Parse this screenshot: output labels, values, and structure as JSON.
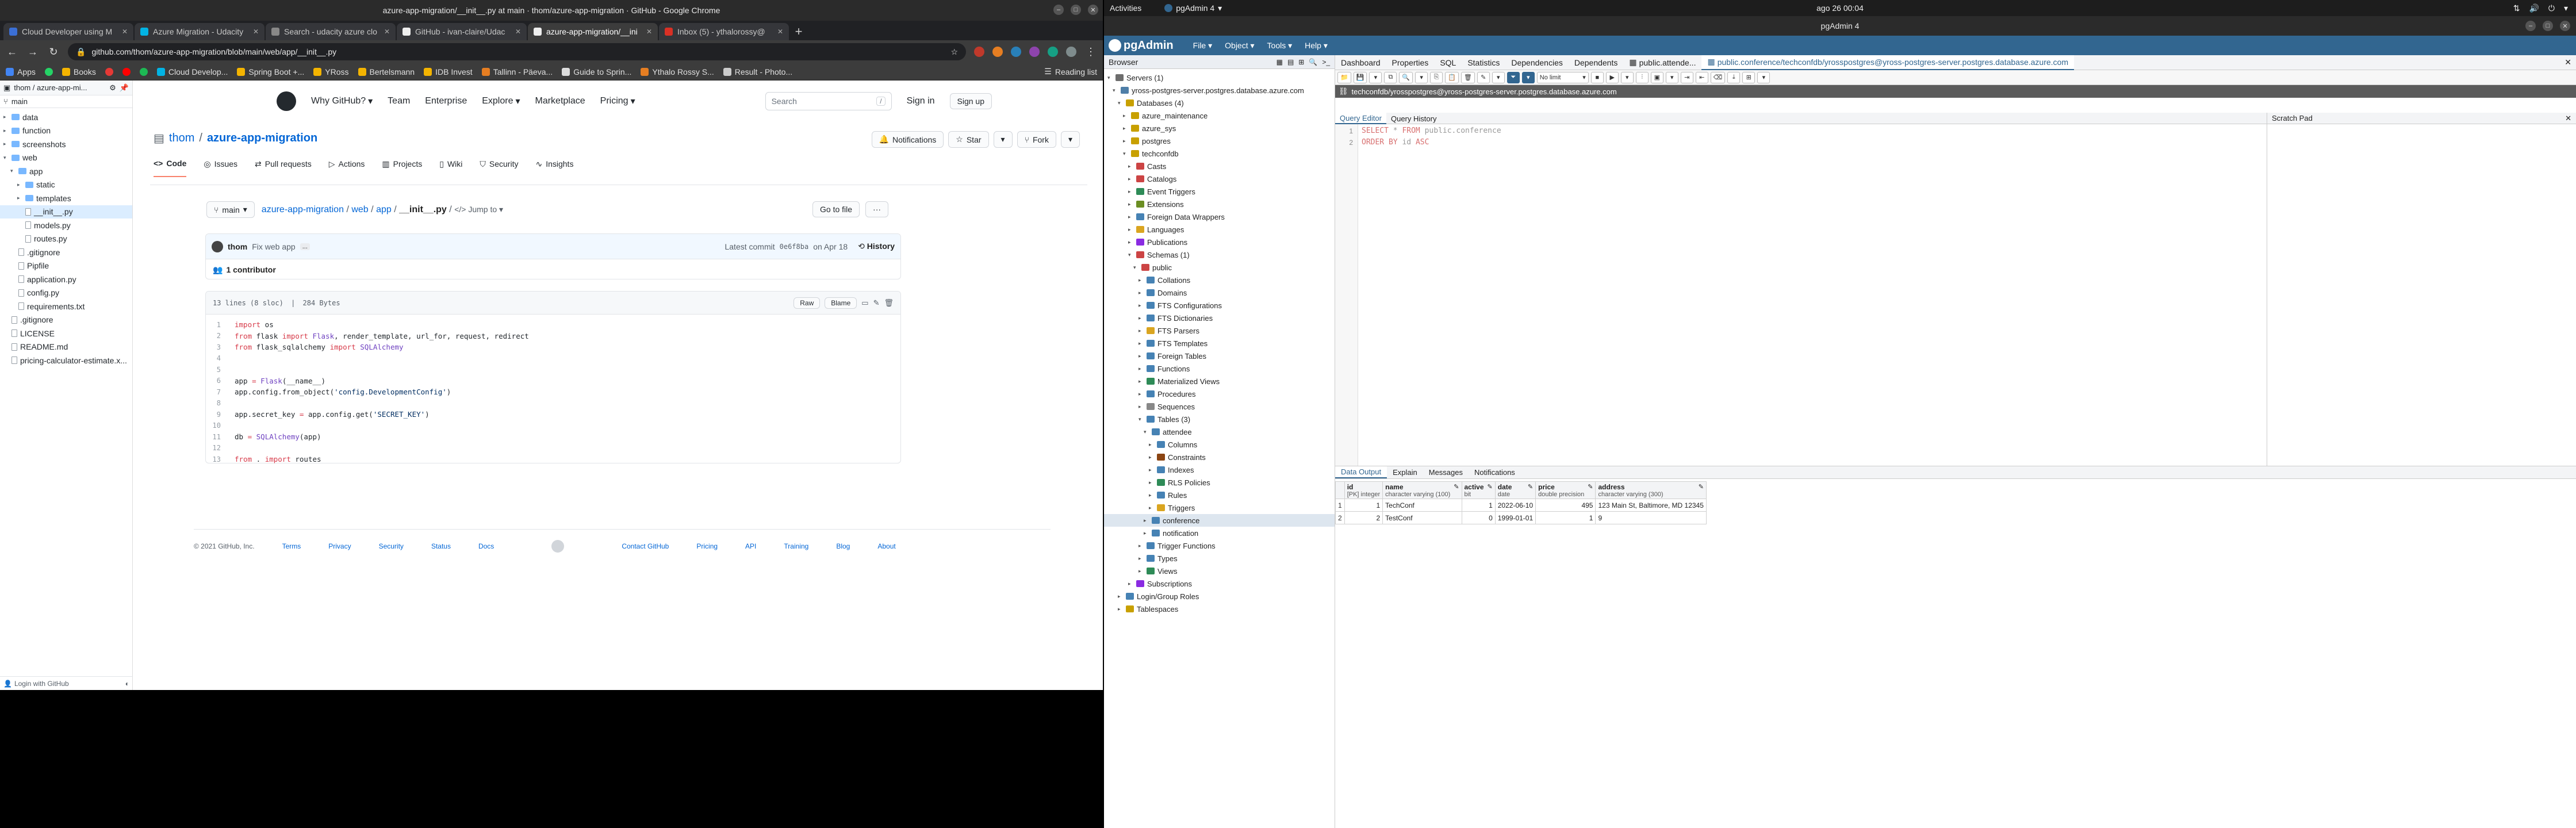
{
  "chrome": {
    "window_title": "azure-app-migration/__init__.py at main · thom/azure-app-migration · GitHub - Google Chrome",
    "tabs": [
      {
        "label": "Cloud Developer using M",
        "active": false
      },
      {
        "label": "Azure Migration - Udacity",
        "active": false
      },
      {
        "label": "Search - udacity azure clo",
        "active": false
      },
      {
        "label": "GitHub - ivan-claire/Udac",
        "active": false
      },
      {
        "label": "azure-app-migration/__ini",
        "active": true
      },
      {
        "label": "Inbox (5) - ythalorossy@",
        "active": false
      }
    ],
    "url": "github.com/thom/azure-app-migration/blob/main/web/app/__init__.py",
    "bookmarks": [
      "Apps",
      "Books",
      "Cloud Develop...",
      "Spring Boot +...",
      "YRoss",
      "Bertelsmann",
      "IDB Invest",
      "Tallinn - Päeva...",
      "Guide to Sprin...",
      "Ythalo Rossy S...",
      "Result - Photo..."
    ],
    "reading_list": "Reading list"
  },
  "octotree": {
    "repo": "thom / azure-app-mi...",
    "branch": "main",
    "items": [
      {
        "label": "data",
        "type": "folder",
        "depth": 0,
        "open": false
      },
      {
        "label": "function",
        "type": "folder",
        "depth": 0,
        "open": false
      },
      {
        "label": "screenshots",
        "type": "folder",
        "depth": 0,
        "open": false
      },
      {
        "label": "web",
        "type": "folder",
        "depth": 0,
        "open": true
      },
      {
        "label": "app",
        "type": "folder",
        "depth": 1,
        "open": true
      },
      {
        "label": "static",
        "type": "folder",
        "depth": 2,
        "open": false
      },
      {
        "label": "templates",
        "type": "folder",
        "depth": 2,
        "open": false
      },
      {
        "label": "__init__.py",
        "type": "file",
        "depth": 2,
        "selected": true
      },
      {
        "label": "models.py",
        "type": "file",
        "depth": 2
      },
      {
        "label": "routes.py",
        "type": "file",
        "depth": 2
      },
      {
        "label": ".gitignore",
        "type": "file",
        "depth": 1
      },
      {
        "label": "Pipfile",
        "type": "file",
        "depth": 1
      },
      {
        "label": "application.py",
        "type": "file",
        "depth": 1
      },
      {
        "label": "config.py",
        "type": "file",
        "depth": 1
      },
      {
        "label": "requirements.txt",
        "type": "file",
        "depth": 1
      },
      {
        "label": ".gitignore",
        "type": "file",
        "depth": 0
      },
      {
        "label": "LICENSE",
        "type": "file",
        "depth": 0
      },
      {
        "label": "README.md",
        "type": "file",
        "depth": 0
      },
      {
        "label": "pricing-calculator-estimate.x...",
        "type": "file",
        "depth": 0
      }
    ],
    "footer": "Login with GitHub"
  },
  "github": {
    "nav": [
      "Why GitHub?",
      "Team",
      "Enterprise",
      "Explore",
      "Marketplace",
      "Pricing"
    ],
    "search_placeholder": "Search",
    "search_key": "/",
    "sign_in": "Sign in",
    "sign_up": "Sign up",
    "owner": "thom",
    "repo": "azure-app-migration",
    "notifications": "Notifications",
    "star": "Star",
    "fork": "Fork",
    "repo_tabs": [
      "Code",
      "Issues",
      "Pull requests",
      "Actions",
      "Projects",
      "Wiki",
      "Security",
      "Insights"
    ],
    "branch": "main",
    "breadcrumb": {
      "repo": "azure-app-migration",
      "web": "web",
      "app": "app",
      "file": "__init__.py",
      "jump": "Jump to"
    },
    "go_to_file": "Go to file",
    "more": "···",
    "commit": {
      "author": "thom",
      "message": "Fix web app",
      "more": "...",
      "latest": "Latest commit",
      "sha": "0e6f8ba",
      "date": "on Apr 18",
      "history": "History"
    },
    "contributors": "1 contributor",
    "file_info": {
      "lines": "13 lines (8 sloc)",
      "size": "284 Bytes"
    },
    "file_buttons": {
      "raw": "Raw",
      "blame": "Blame"
    },
    "code_lines": [
      "import os",
      "from flask import Flask, render_template, url_for, request, redirect",
      "from flask_sqlalchemy import SQLAlchemy",
      "",
      "",
      "app = Flask(__name__)",
      "app.config.from_object('config.DevelopmentConfig')",
      "",
      "app.secret_key = app.config.get('SECRET_KEY')",
      "",
      "db = SQLAlchemy(app)",
      "",
      "from . import routes"
    ],
    "footer": {
      "copyright": "© 2021 GitHub, Inc.",
      "links_left": [
        "Terms",
        "Privacy",
        "Security",
        "Status",
        "Docs"
      ],
      "links_right": [
        "Contact GitHub",
        "Pricing",
        "API",
        "Training",
        "Blog",
        "About"
      ]
    }
  },
  "gnome": {
    "activities": "Activities",
    "app": "pgAdmin 4",
    "clock": "ago 26 00:04"
  },
  "pgadmin": {
    "window_title": "pgAdmin 4",
    "logo": "pgAdmin",
    "menus": [
      "File",
      "Object",
      "Tools",
      "Help"
    ],
    "browser_title": "Browser",
    "tree": [
      {
        "label": "Servers (1)",
        "depth": 0,
        "color": "#6d6d6d"
      },
      {
        "label": "yross-postgres-server.postgres.database.azure.com",
        "depth": 1,
        "color": "#4f7fa8"
      },
      {
        "label": "Databases (4)",
        "depth": 2,
        "color": "#c8a000"
      },
      {
        "label": "azure_maintenance",
        "depth": 3,
        "color": "#c8a000"
      },
      {
        "label": "azure_sys",
        "depth": 3,
        "color": "#c8a000"
      },
      {
        "label": "postgres",
        "depth": 3,
        "color": "#c8a000"
      },
      {
        "label": "techconfdb",
        "depth": 3,
        "color": "#c8a000"
      },
      {
        "label": "Casts",
        "depth": 4,
        "color": "#cc4444"
      },
      {
        "label": "Catalogs",
        "depth": 4,
        "color": "#cc4444"
      },
      {
        "label": "Event Triggers",
        "depth": 4,
        "color": "#2e8b57"
      },
      {
        "label": "Extensions",
        "depth": 4,
        "color": "#6b8e23"
      },
      {
        "label": "Foreign Data Wrappers",
        "depth": 4,
        "color": "#4682b4"
      },
      {
        "label": "Languages",
        "depth": 4,
        "color": "#daa520"
      },
      {
        "label": "Publications",
        "depth": 4,
        "color": "#8a2be2"
      },
      {
        "label": "Schemas (1)",
        "depth": 4,
        "color": "#cc4444"
      },
      {
        "label": "public",
        "depth": 5,
        "color": "#cc4444"
      },
      {
        "label": "Collations",
        "depth": 6,
        "color": "#4682b4"
      },
      {
        "label": "Domains",
        "depth": 6,
        "color": "#4682b4"
      },
      {
        "label": "FTS Configurations",
        "depth": 6,
        "color": "#4682b4"
      },
      {
        "label": "FTS Dictionaries",
        "depth": 6,
        "color": "#4682b4"
      },
      {
        "label": "FTS Parsers",
        "depth": 6,
        "color": "#daa520"
      },
      {
        "label": "FTS Templates",
        "depth": 6,
        "color": "#4682b4"
      },
      {
        "label": "Foreign Tables",
        "depth": 6,
        "color": "#4682b4"
      },
      {
        "label": "Functions",
        "depth": 6,
        "color": "#4682b4"
      },
      {
        "label": "Materialized Views",
        "depth": 6,
        "color": "#2e8b57"
      },
      {
        "label": "Procedures",
        "depth": 6,
        "color": "#4682b4"
      },
      {
        "label": "Sequences",
        "depth": 6,
        "color": "#888888"
      },
      {
        "label": "Tables (3)",
        "depth": 6,
        "color": "#4682b4"
      },
      {
        "label": "attendee",
        "depth": 7,
        "color": "#4682b4"
      },
      {
        "label": "Columns",
        "depth": 8,
        "color": "#4682b4"
      },
      {
        "label": "Constraints",
        "depth": 8,
        "color": "#8b4513"
      },
      {
        "label": "Indexes",
        "depth": 8,
        "color": "#4682b4"
      },
      {
        "label": "RLS Policies",
        "depth": 8,
        "color": "#2e8b57"
      },
      {
        "label": "Rules",
        "depth": 8,
        "color": "#4682b4"
      },
      {
        "label": "Triggers",
        "depth": 8,
        "color": "#daa520"
      },
      {
        "label": "conference",
        "depth": 7,
        "color": "#4682b4",
        "selected": true
      },
      {
        "label": "notification",
        "depth": 7,
        "color": "#4682b4"
      },
      {
        "label": "Trigger Functions",
        "depth": 6,
        "color": "#4682b4"
      },
      {
        "label": "Types",
        "depth": 6,
        "color": "#4682b4"
      },
      {
        "label": "Views",
        "depth": 6,
        "color": "#2e8b57"
      },
      {
        "label": "Subscriptions",
        "depth": 4,
        "color": "#8a2be2"
      },
      {
        "label": "Login/Group Roles",
        "depth": 2,
        "color": "#4682b4"
      },
      {
        "label": "Tablespaces",
        "depth": 2,
        "color": "#c8a000"
      }
    ],
    "main_tabs": [
      "Dashboard",
      "Properties",
      "SQL",
      "Statistics",
      "Dependencies",
      "Dependents",
      "public.attende...",
      "public.conference/techconfdb/yrosspostgres@yross-postgres-server.postgres.database.azure.com"
    ],
    "limit": "No limit",
    "connection": "techconfdb/yrosspostgres@yross-postgres-server.postgres.database.azure.com",
    "editor_tabs": [
      "Query Editor",
      "Query History"
    ],
    "scratch_pad": "Scratch Pad",
    "sql_lines": [
      "SELECT * FROM public.conference",
      "ORDER BY id ASC"
    ],
    "result_tabs": [
      "Data Output",
      "Explain",
      "Messages",
      "Notifications"
    ],
    "columns": [
      {
        "name": "id",
        "type": "[PK] integer"
      },
      {
        "name": "name",
        "type": "character varying (100)"
      },
      {
        "name": "active",
        "type": "bit"
      },
      {
        "name": "date",
        "type": "date"
      },
      {
        "name": "price",
        "type": "double precision"
      },
      {
        "name": "address",
        "type": "character varying (300)"
      }
    ],
    "rows": [
      [
        "1",
        "1",
        "TechConf",
        "1",
        "2022-06-10",
        "495",
        "123 Main St, Baltimore, MD 12345"
      ],
      [
        "2",
        "2",
        "TestConf",
        "0",
        "1999-01-01",
        "1",
        "9"
      ]
    ]
  }
}
